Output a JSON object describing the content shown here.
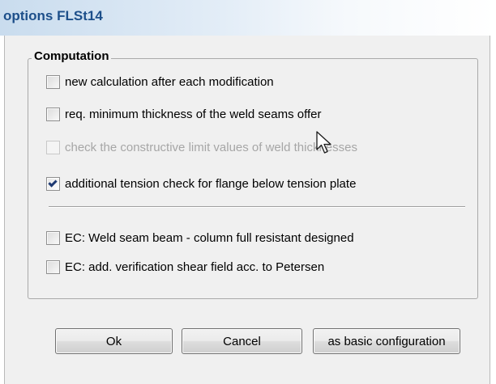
{
  "window": {
    "title": "options FLSt14"
  },
  "group": {
    "title": "Computation"
  },
  "options": [
    {
      "label": "new calculation after each modification",
      "checked": false,
      "enabled": true
    },
    {
      "label": "req. minimum thickness of the weld seams offer",
      "checked": false,
      "enabled": true
    },
    {
      "label": "check the constructive limit values of weld thicknesses",
      "checked": false,
      "enabled": false
    },
    {
      "label": "additional tension check for flange below tension plate",
      "checked": true,
      "enabled": true
    },
    {
      "label": "EC: Weld seam beam - column full resistant designed",
      "checked": false,
      "enabled": true
    },
    {
      "label": "EC: add. verification shear field acc. to Petersen",
      "checked": false,
      "enabled": true
    }
  ],
  "buttons": {
    "ok": "Ok",
    "cancel": "Cancel",
    "basic": "as basic configuration"
  },
  "icons": {
    "check": "check-mark-icon",
    "cursor": "mouse-cursor-icon"
  },
  "colors": {
    "title_text": "#1d4f8a",
    "client_bg": "#f0f0f0",
    "check_mark": "#1f3a73",
    "disabled_text": "#a6a6a6"
  }
}
